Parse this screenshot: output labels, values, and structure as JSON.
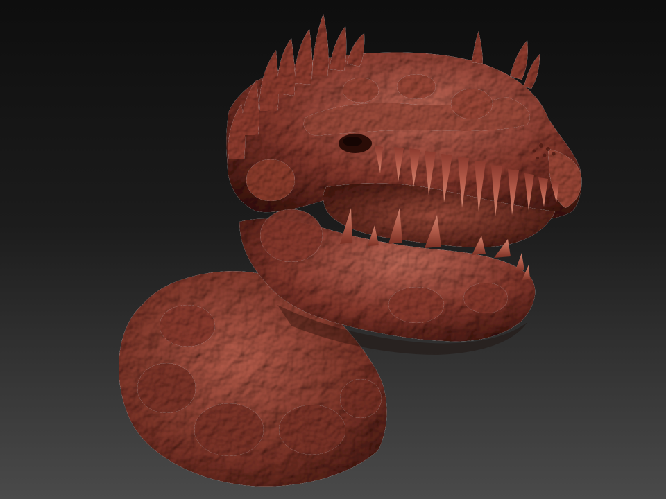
{
  "viewport": {
    "background_top": "#0e0e0e",
    "background_bottom": "#4a4a4a"
  },
  "sculpt": {
    "subject": "creature-head-sculpt",
    "material_color": "#8a3a2e",
    "highlight_color": "#c26a58",
    "shadow_color": "#3a120c",
    "tooth_color": "#a54a3b"
  }
}
